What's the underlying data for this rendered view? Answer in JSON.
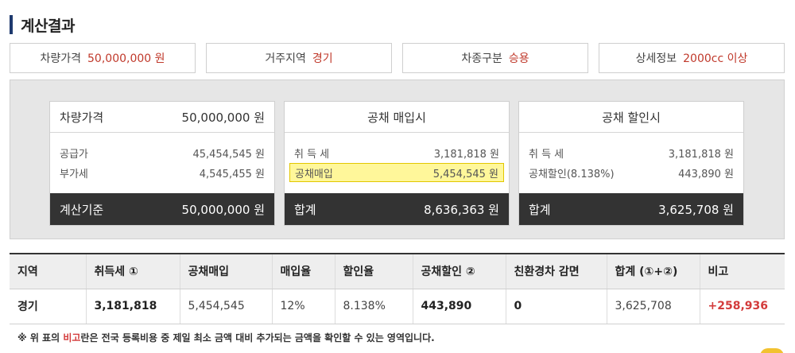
{
  "section": {
    "title": "계산결과"
  },
  "summary": [
    {
      "label": "차량가격",
      "value": "50,000,000 원"
    },
    {
      "label": "거주지역",
      "value": "경기"
    },
    {
      "label": "차종구분",
      "value": "승용"
    },
    {
      "label": "상세정보",
      "value": "2000cc 이상"
    }
  ],
  "card_price": {
    "head_label": "차량가격",
    "head_value": "50,000,000 원",
    "rows": [
      {
        "label": "공급가",
        "value": "45,454,545 원"
      },
      {
        "label": "부가세",
        "value": "4,545,455 원"
      }
    ],
    "foot_label": "계산기준",
    "foot_value": "50,000,000 원"
  },
  "card_buy": {
    "title": "공채 매입시",
    "rows": [
      {
        "label": "취 득 세",
        "value": "3,181,818 원"
      },
      {
        "label": "공채매입",
        "value": "5,454,545 원"
      }
    ],
    "foot_label": "합계",
    "foot_value": "8,636,363 원"
  },
  "card_discount": {
    "title": "공채 할인시",
    "rows": [
      {
        "label": "취 득 세",
        "value": "3,181,818 원"
      },
      {
        "label": "공채할인(8.138%)",
        "value": "443,890 원"
      }
    ],
    "foot_label": "합계",
    "foot_value": "3,625,708 원"
  },
  "table": {
    "headers": [
      "지역",
      "취득세 ①",
      "공채매입",
      "매입율",
      "할인율",
      "공채할인 ②",
      "친환경차 감면",
      "합계 (①+②)",
      "비고"
    ],
    "row": [
      "경기",
      "3,181,818",
      "5,454,545",
      "12%",
      "8.138%",
      "443,890",
      "0",
      "3,625,708",
      "+258,936"
    ]
  },
  "note": {
    "pre": "※ 위 표의 ",
    "em": "비고",
    "post": "란은 전국 등록비용 중 제일 최소 금액 대비 추가되는 금액을 확인할 수 있는 영역입니다."
  }
}
